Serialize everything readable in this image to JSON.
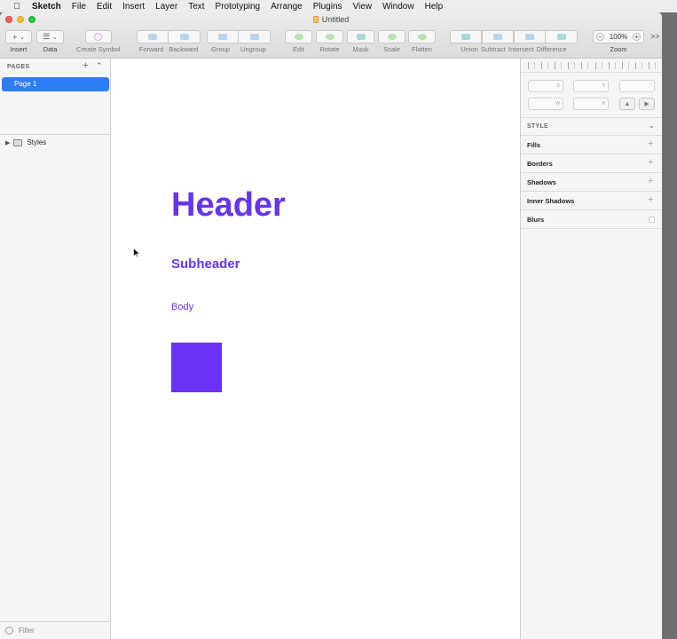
{
  "menubar": {
    "app": "Sketch",
    "items": [
      "File",
      "Edit",
      "Insert",
      "Layer",
      "Text",
      "Prototyping",
      "Arrange",
      "Plugins",
      "View",
      "Window",
      "Help"
    ]
  },
  "window": {
    "title": "Untitled"
  },
  "toolbar": {
    "insert": {
      "glyph": "+",
      "label": "Insert"
    },
    "data": {
      "label": "Data"
    },
    "create_symbol": "Create Symbol",
    "forward": "Forward",
    "backward": "Backward",
    "group": "Group",
    "ungroup": "Ungroup",
    "edit": "Edit",
    "rotate": "Rotate",
    "mask": "Mask",
    "scale": "Scale",
    "flatten": "Flatten",
    "union": "Union",
    "subtract": "Subtract",
    "intersect": "Intersect",
    "difference": "Difference",
    "zoom_label": "Zoom",
    "zoom_value": "100%",
    "zoom_minus": "−",
    "zoom_plus": "+",
    "overflow": ">>"
  },
  "left_panel": {
    "pages_header": "PAGES",
    "add_glyph": "+",
    "pages": [
      "Page 1"
    ],
    "layers": [
      {
        "name": "Styles",
        "expanded": false
      }
    ],
    "filter_placeholder": "Filter"
  },
  "canvas": {
    "header_text": "Header",
    "subheader_text": "Subheader",
    "body_text": "Body",
    "accent_color": "#6634f0"
  },
  "inspector": {
    "x_label": "X",
    "y_label": "Y",
    "rotation_label": "°",
    "w_label": "W",
    "h_label": "H",
    "style_header": "STYLE",
    "sections": [
      "Fills",
      "Borders",
      "Shadows",
      "Inner Shadows",
      "Blurs"
    ]
  }
}
